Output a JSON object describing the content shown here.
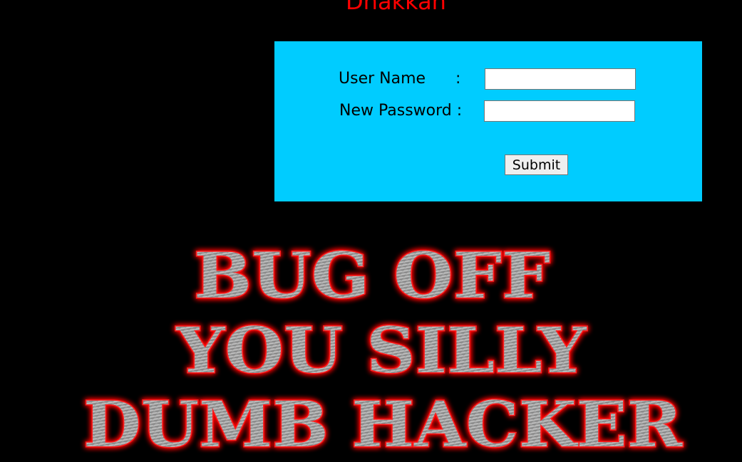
{
  "header": {
    "title": "Dhakkan"
  },
  "form": {
    "username_label": "User Name      :",
    "password_label": "New Password :",
    "username_value": "",
    "password_value": "",
    "submit_label": "Submit"
  },
  "banner": {
    "line1": "BUG OFF",
    "line2": "YOU SILLY",
    "line3": "DUMB HACKER"
  },
  "colors": {
    "background": "#000000",
    "title": "#ff0000",
    "form_panel": "#00ccff",
    "banner_glow": "#ff0000",
    "banner_metal": "#a8a8a8"
  }
}
